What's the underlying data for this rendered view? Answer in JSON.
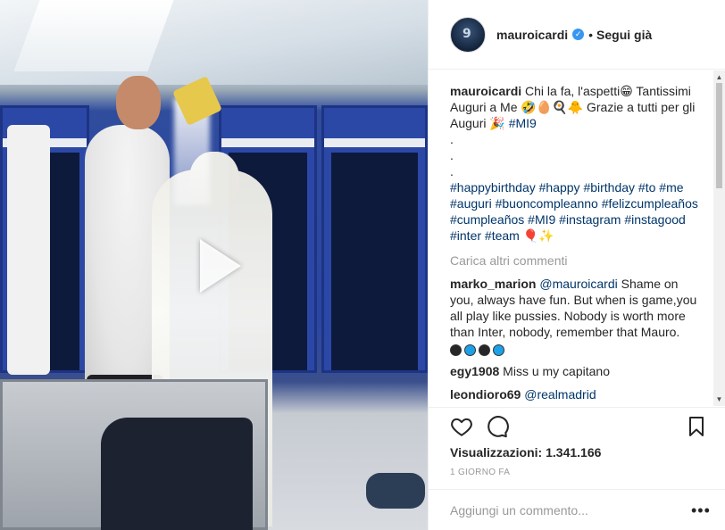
{
  "header": {
    "username": "mauroicardi",
    "separator": "•",
    "follow_label": "Segui già",
    "avatar_number": "9"
  },
  "caption": {
    "username": "mauroicardi",
    "text_line": "Chi la fa, l'aspetti😁 Tantissimi Auguri a Me 🤣🥚🍳🐥 Grazie a tutti per gli Auguri 🎉",
    "hashtag_main": "#MI9",
    "dot": ".",
    "hashtags": "#happybirthday #happy #birthday #to #me #auguri #buoncompleanno #felizcumpleaños #cumpleaños #MI9 #instagram #instagood #inter #team 🎈✨"
  },
  "load_more_label": "Carica altri commenti",
  "comments": [
    {
      "username": "marko_marion",
      "mention": "@mauroicardi",
      "text": "Shame on you, always have fun. But when is game,you all play like pussies. Nobody is worth more than Inter, nobody, remember that Mauro.",
      "circle_colors": [
        "#262626",
        "#1da1e6",
        "#262626",
        "#1da1e6"
      ]
    },
    {
      "username": "egy1908",
      "mention": "",
      "text": "Miss u my capitano"
    },
    {
      "username": "leondioro69",
      "mention": "@realmadrid",
      "text": ""
    }
  ],
  "actions": {
    "like_icon": "heart-icon",
    "comment_icon": "comment-bubble-icon",
    "save_icon": "bookmark-icon"
  },
  "views": {
    "label": "Visualizzazioni:",
    "count": "1.341.166"
  },
  "time_ago": "1 GIORNO FA",
  "add_comment": {
    "placeholder": "Aggiungi un commento...",
    "more_label": "•••"
  },
  "colors": {
    "link": "#003569",
    "verified": "#3897f0",
    "muted": "#999999",
    "locker_blue": "#2c48a6"
  }
}
